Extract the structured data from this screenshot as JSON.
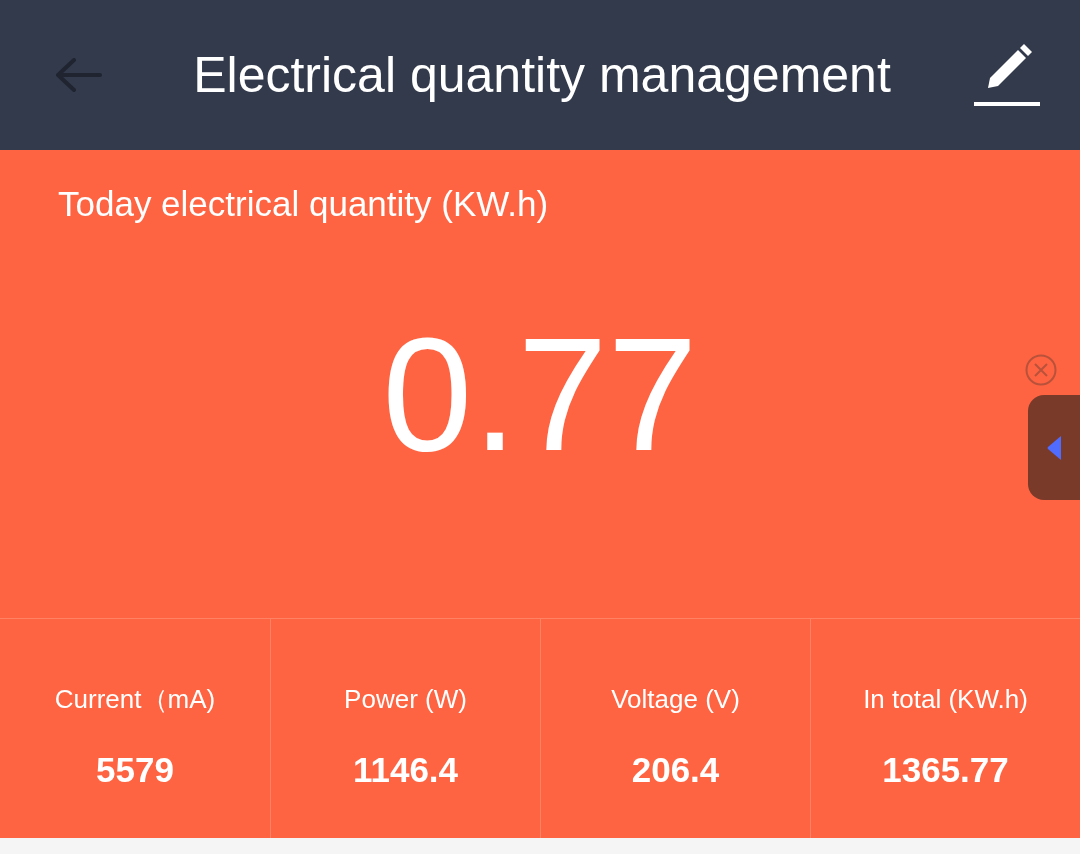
{
  "header": {
    "title": "Electrical quantity management"
  },
  "today": {
    "label": "Today electrical quantity (KW.h)",
    "value": "0.77"
  },
  "stats": [
    {
      "label": "Current（mA)",
      "value": "5579"
    },
    {
      "label": "Power (W)",
      "value": "1146.4"
    },
    {
      "label": "Voltage (V)",
      "value": "206.4"
    },
    {
      "label": "In total (KW.h)",
      "value": "1365.77"
    }
  ]
}
